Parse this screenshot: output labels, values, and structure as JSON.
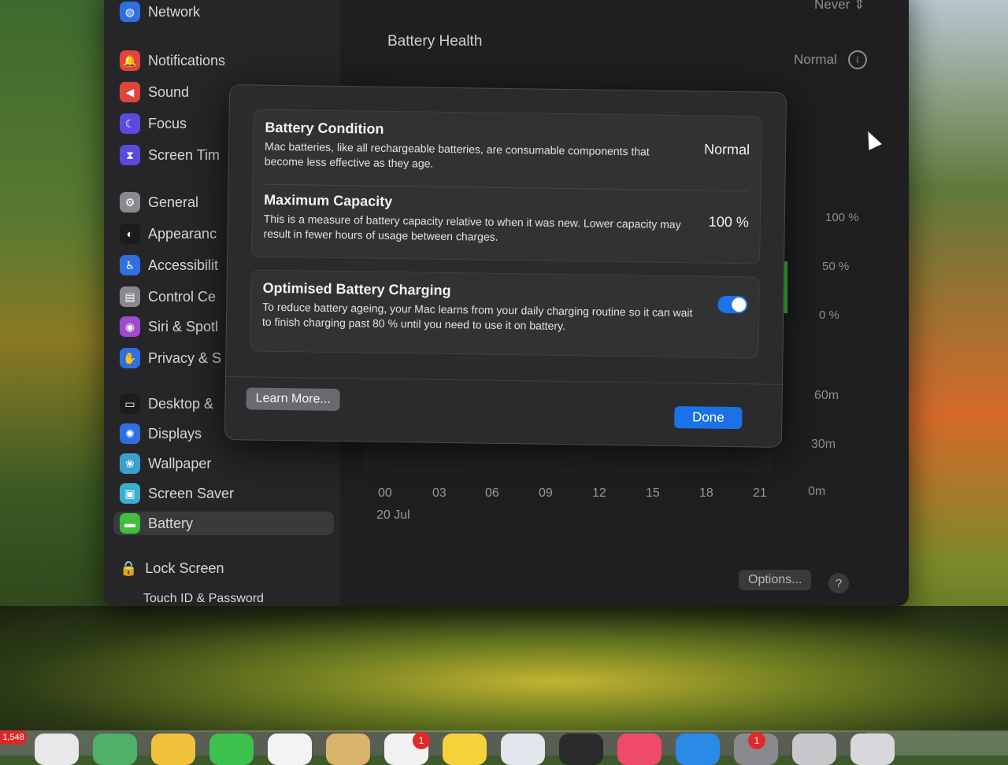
{
  "sidebar": {
    "items": [
      {
        "label": "Network",
        "icon": "globe-icon",
        "color": "#2f6fe0"
      },
      {
        "label": "Notifications",
        "icon": "bell-icon",
        "color": "#e0443a"
      },
      {
        "label": "Sound",
        "icon": "speaker-icon",
        "color": "#e0443a"
      },
      {
        "label": "Focus",
        "icon": "moon-icon",
        "color": "#5a4ae0"
      },
      {
        "label": "Screen Tim",
        "icon": "hourglass-icon",
        "color": "#5a4ae0"
      },
      {
        "label": "General",
        "icon": "gear-icon",
        "color": "#8a8a8e"
      },
      {
        "label": "Appearanc",
        "icon": "appearance-icon",
        "color": "#1c1c1e"
      },
      {
        "label": "Accessibilit",
        "icon": "accessibility-icon",
        "color": "#2f6fe0"
      },
      {
        "label": "Control Ce",
        "icon": "control-center-icon",
        "color": "#8a8a8e"
      },
      {
        "label": "Siri & Spotl",
        "icon": "siri-icon",
        "color": "#a04ad0"
      },
      {
        "label": "Privacy & S",
        "icon": "hand-icon",
        "color": "#2f6fe0"
      },
      {
        "label": "Desktop &",
        "icon": "desktop-icon",
        "color": "#1c1c1e"
      },
      {
        "label": "Displays",
        "icon": "display-icon",
        "color": "#2f6fe0"
      },
      {
        "label": "Wallpaper",
        "icon": "wallpaper-icon",
        "color": "#3aa0d0"
      },
      {
        "label": "Screen Saver",
        "icon": "screensaver-icon",
        "color": "#3ab0d0"
      },
      {
        "label": "Battery",
        "icon": "battery-icon",
        "color": "#3fbf3a"
      }
    ],
    "lock_screen": "Lock Screen",
    "touch_id": "Touch ID & Password"
  },
  "main": {
    "title": "Battery Health",
    "never": "Never ⇕",
    "status": "Normal",
    "percent_labels": [
      "100 %",
      "50 %",
      "0 %"
    ],
    "time_labels": [
      "60m",
      "30m",
      "0m"
    ],
    "hours": [
      "00",
      "03",
      "06",
      "09",
      "12",
      "15",
      "18",
      "21"
    ],
    "date": "20 Jul",
    "options": "Options...",
    "help": "?"
  },
  "modal": {
    "condition_title": "Battery Condition",
    "condition_desc": "Mac batteries, like all rechargeable batteries, are consumable components that become less effective as they age.",
    "condition_value": "Normal",
    "capacity_title": "Maximum Capacity",
    "capacity_desc": "This is a measure of battery capacity relative to when it was new. Lower capacity may result in fewer hours of usage between charges.",
    "capacity_value": "100 %",
    "optimised_title": "Optimised Battery Charging",
    "optimised_desc": "To reduce battery ageing, your Mac learns from your daily charging routine so it can wait to finish charging past 80 % until you need to use it on battery.",
    "optimised_enabled": true,
    "learn_more": "Learn More...",
    "done": "Done"
  },
  "dock": {
    "badge_mail": "1",
    "badge_other": "1",
    "memory_badge": "1,548"
  }
}
